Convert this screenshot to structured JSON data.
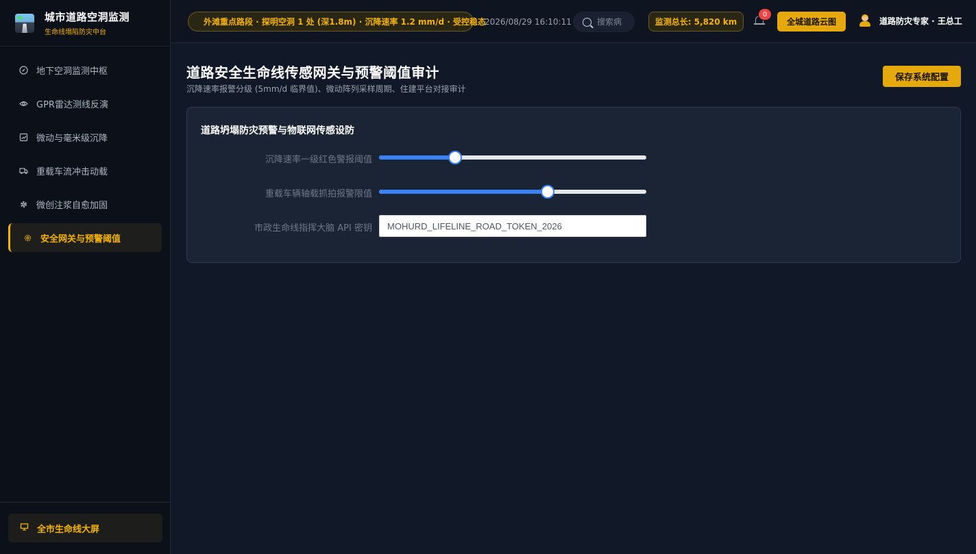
{
  "brand": {
    "title": "城市道路空洞监测",
    "subtitle": "生命线塌陷防灾中台"
  },
  "sidebar": {
    "items": [
      {
        "label": "地下空洞监测中枢",
        "icon": "compass-icon",
        "active": false
      },
      {
        "label": "GPR雷达测线反演",
        "icon": "eye-icon",
        "active": false
      },
      {
        "label": "微动与毫米级沉降",
        "icon": "chart-icon",
        "active": false
      },
      {
        "label": "重载车流冲击动载",
        "icon": "truck-icon",
        "active": false
      },
      {
        "label": "微创注浆自愈加固",
        "icon": "gear-icon",
        "active": false
      },
      {
        "label": "安全网关与预警阈值",
        "icon": "settings-icon",
        "active": true
      }
    ],
    "footer_label": "全市生命线大屏"
  },
  "header": {
    "alert_text": "外滩重点路段 · 探明空洞 1 处 (深1.8m) · 沉降速率 1.2 mm/d · 受控稳态",
    "datetime": "2026/08/29 16:10:11",
    "search_placeholder": "搜索病",
    "stat_text": "监测总长: 5,820 km",
    "notification_count": "0",
    "cloud_button": "全城道路云图",
    "user_name": "道路防灾专家 · 王总工"
  },
  "main": {
    "title": "道路安全生命线传感网关与预警阈值审计",
    "subtitle": "沉降速率报警分级 (5mm/d 临界值)、微动阵列采样周期、住建平台对接审计",
    "save_button": "保存系统配置",
    "card": {
      "title": "道路坍塌防灾预警与物联网传感设防",
      "settlement_label": "沉降速率一级红色警报阈值",
      "settlement_value_fraction": 0.285,
      "axle_label": "重载车辆轴载抓拍报警限值",
      "axle_value_fraction": 0.63,
      "api_label": "市政生命线指挥大脑 API 密钥",
      "api_value": "MOHURD_LIFELINE_ROAD_TOKEN_2026"
    }
  },
  "colors": {
    "accent": "#f5b301",
    "slider": "#3b82f6",
    "badge": "#ef4444"
  }
}
